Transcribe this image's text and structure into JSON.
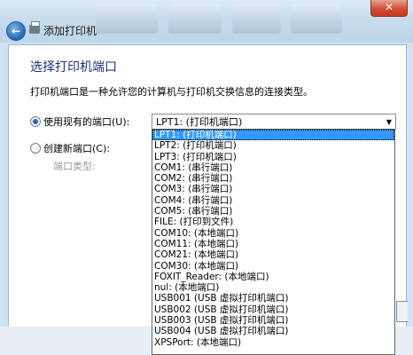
{
  "window": {
    "title": "添加打印机",
    "close_glyph": "✕"
  },
  "page": {
    "heading": "选择打印机端口",
    "description": "打印机端口是一种允许您的计算机与打印机交换信息的连接类型。",
    "use_existing_label": "使用现有的端口(U):",
    "create_new_label": "创建新端口(C):",
    "port_type_label": "端口类型:"
  },
  "combo": {
    "selected_value": "LPT1: (打印机端口)"
  },
  "dropdown": {
    "selected_index": 0,
    "options": [
      "LPT1: (打印机端口)",
      "LPT2: (打印机端口)",
      "LPT3: (打印机端口)",
      "COM1: (串行端口)",
      "COM2: (串行端口)",
      "COM3: (串行端口)",
      "COM4: (串行端口)",
      "COM5: (串行端口)",
      "FILE: (打印到文件)",
      "COM10: (本地端口)",
      "COM11: (本地端口)",
      "COM21: (本地端口)",
      "COM30: (本地端口)",
      "FOXIT_Reader: (本地端口)",
      "nul: (本地端口)",
      "USB001 (USB 虚拟打印机端口)",
      "USB002 (USB 虚拟打印机端口)",
      "USB003 (USB 虚拟打印机端口)",
      "USB004 (USB 虚拟打印机端口)",
      "XPSPort: (本地端口)"
    ]
  },
  "icons": {
    "back": "back-arrow-icon",
    "printer": "printer-icon",
    "dropdown": "chevron-down-icon"
  }
}
